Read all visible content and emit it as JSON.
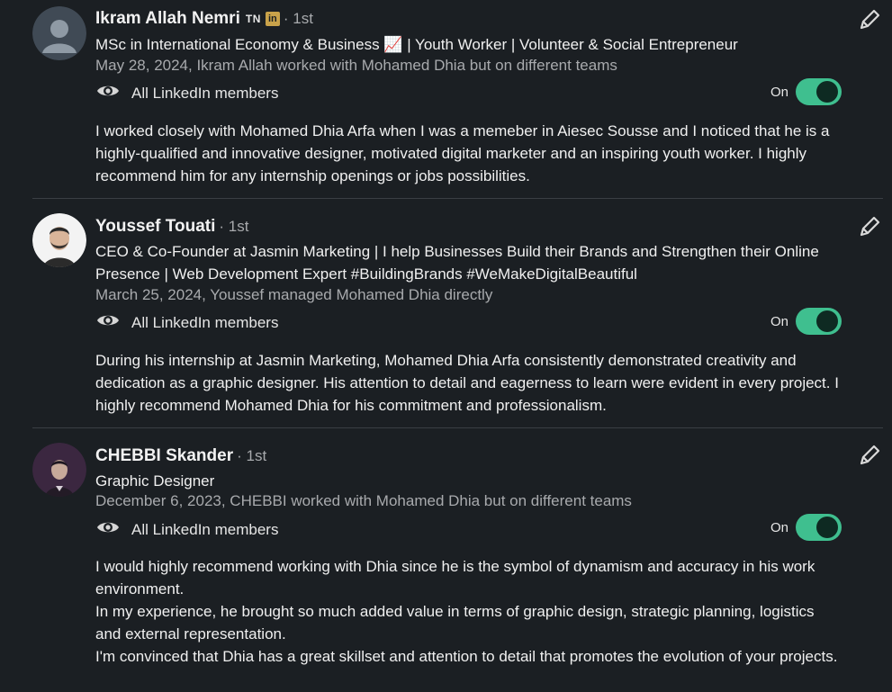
{
  "recommendations": [
    {
      "name": "Ikram Allah Nemri",
      "flag": "TN",
      "badge": "in",
      "degree": "· 1st",
      "headline": "MSc in International Economy & Business 📈 | Youth Worker | Volunteer & Social Entrepreneur",
      "meta": "May 28, 2024, Ikram Allah worked with Mohamed Dhia but on different teams",
      "visibility": "All LinkedIn members",
      "toggle_label": "On",
      "body": [
        "I worked closely with Mohamed Dhia Arfa when I was a memeber in Aiesec Sousse and I noticed that he is a highly-qualified and innovative designer, motivated digital marketer and an inspiring youth worker. I highly recommend him for any internship openings or jobs possibilities."
      ]
    },
    {
      "name": "Youssef Touati",
      "degree": "· 1st",
      "headline": "CEO & Co-Founder at Jasmin Marketing | I help Businesses Build their Brands and Strengthen their Online Presence | Web Development Expert #BuildingBrands #WeMakeDigitalBeautiful",
      "meta": "March 25, 2024, Youssef managed Mohamed Dhia directly",
      "visibility": "All LinkedIn members",
      "toggle_label": "On",
      "body": [
        "During his internship at Jasmin Marketing, Mohamed Dhia Arfa consistently demonstrated creativity and dedication as a graphic designer. His attention to detail and eagerness to learn were evident in every project. I highly recommend Mohamed Dhia for his commitment and professionalism."
      ]
    },
    {
      "name": "CHEBBI Skander",
      "degree": "· 1st",
      "headline": "Graphic Designer",
      "meta": "December 6, 2023, CHEBBI worked with Mohamed Dhia but on different teams",
      "visibility": "All LinkedIn members",
      "toggle_label": "On",
      "body": [
        "I would highly recommend working with Dhia since he is the symbol of dynamism and accuracy in his work environment.",
        "In my experience, he brought so much added value in terms of graphic design, strategic planning, logistics and external representation.",
        "I'm convinced that Dhia has a great skillset and attention to detail that promotes the evolution of your projects."
      ]
    }
  ],
  "colors": {
    "toggle_on": "#3fbf8f",
    "background": "#1b1f23"
  }
}
